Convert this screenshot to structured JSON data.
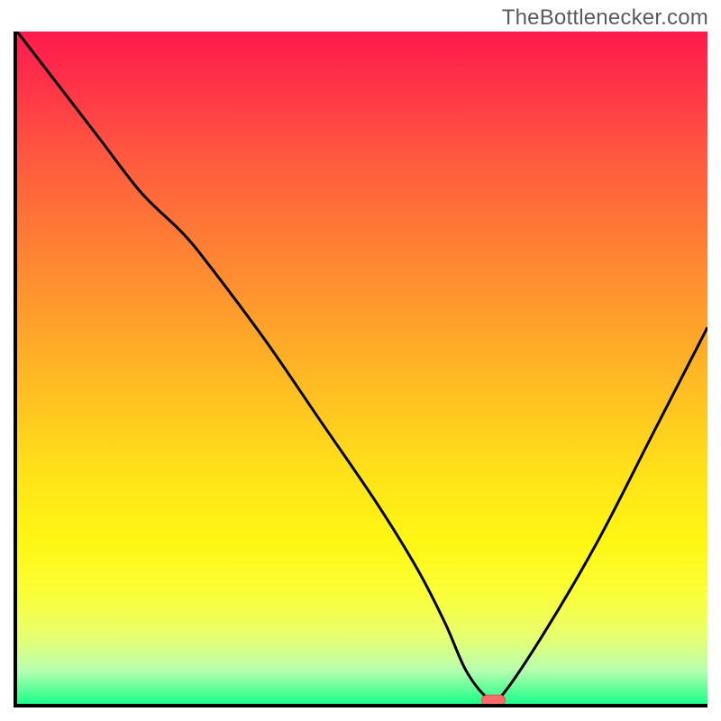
{
  "attribution": "TheBottlenecker.com",
  "colors": {
    "curve": "#000000",
    "marker_fill": "#ff6a6a",
    "marker_stroke": "#e05050"
  },
  "chart_data": {
    "type": "line",
    "title": "",
    "xlabel": "",
    "ylabel": "",
    "xlim": [
      0,
      100
    ],
    "ylim": [
      0,
      100
    ],
    "series": [
      {
        "name": "bottleneck-curve",
        "x": [
          0,
          6,
          12,
          18,
          24,
          28,
          36,
          44,
          52,
          58,
          62,
          65,
          68,
          70,
          76,
          84,
          92,
          100
        ],
        "values": [
          100,
          92,
          84,
          76,
          70,
          65,
          54,
          42,
          30,
          20,
          12,
          5,
          1,
          1,
          10,
          24,
          40,
          56
        ]
      }
    ],
    "annotations": [
      {
        "name": "optimal-marker",
        "x": 69,
        "y": 0.5,
        "shape": "rounded-rect"
      }
    ],
    "background_gradient": {
      "type": "vertical",
      "stops": [
        {
          "pos": 0.0,
          "color": "#ff1a4d"
        },
        {
          "pos": 0.3,
          "color": "#ff7a36"
        },
        {
          "pos": 0.6,
          "color": "#ffd81f"
        },
        {
          "pos": 0.85,
          "color": "#f5ff55"
        },
        {
          "pos": 1.0,
          "color": "#1aff88"
        }
      ]
    }
  }
}
